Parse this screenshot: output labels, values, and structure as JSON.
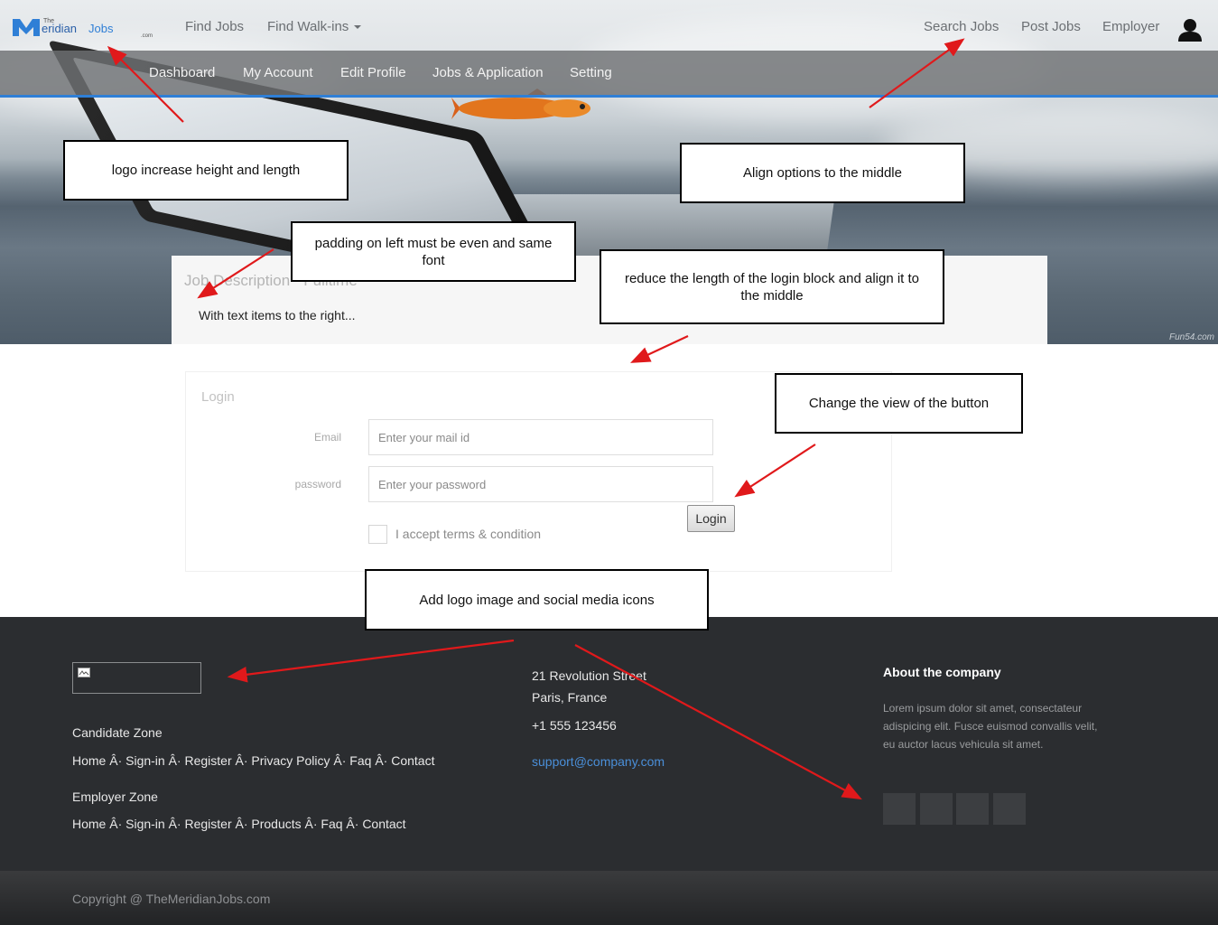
{
  "brand": {
    "logo_text": "TheMeridianJobs",
    "logo_sub": ".com",
    "accent": "#2f7fd6"
  },
  "topnav": {
    "left_links": [
      "Find Jobs",
      "Find Walk-ins"
    ],
    "right_links": [
      "Search Jobs",
      "Post Jobs",
      "Employer"
    ],
    "user_icon": "user-icon"
  },
  "subnav": {
    "items": [
      "Dashboard",
      "My Account",
      "Edit Profile",
      "Jobs & Application",
      "Setting"
    ]
  },
  "hero": {
    "watermark": "Fun54.com"
  },
  "job_panel": {
    "title": "Job Description - Fulltime",
    "subtitle": "With text items to the right..."
  },
  "login": {
    "title": "Login",
    "email_label": "Email",
    "email_placeholder": "Enter your mail id",
    "password_label": "password",
    "password_placeholder": "Enter your password",
    "terms_label": "I accept terms & condition",
    "button_label": "Login"
  },
  "footer": {
    "candidate_heading": "Candidate Zone",
    "candidate_links": "Home Â· Sign-in Â· Register Â· Privacy Policy Â· Faq Â· Contact",
    "employer_heading": "Employer Zone",
    "employer_links": "Home Â· Sign-in Â· Register Â· Products Â· Faq Â· Contact",
    "address_line1": "21 Revolution Street",
    "address_line2": "Paris, France",
    "phone": "+1 555 123456",
    "email": "support@company.com",
    "about_title": "About the company",
    "about_body": "Lorem ipsum dolor sit amet, consectateur adispicing elit. Fusce euismod convallis velit, eu auctor lacus vehicula sit amet.",
    "social_icons": [
      "social-icon-1",
      "social-icon-2",
      "social-icon-3",
      "social-icon-4"
    ],
    "copyright": "Copyright @ TheMeridianJobs.com"
  },
  "annotations": [
    "logo increase height and length",
    "Align options  to the middle",
    "padding on left must be even and same font",
    "reduce the length of the login block and align it to the middle",
    "Change the view of the button",
    "Add logo image and social media icons"
  ],
  "colors": {
    "annotation_arrow": "#e0191b",
    "footer_bg": "#2b2d30",
    "link_blue": "#4a8fd9"
  }
}
